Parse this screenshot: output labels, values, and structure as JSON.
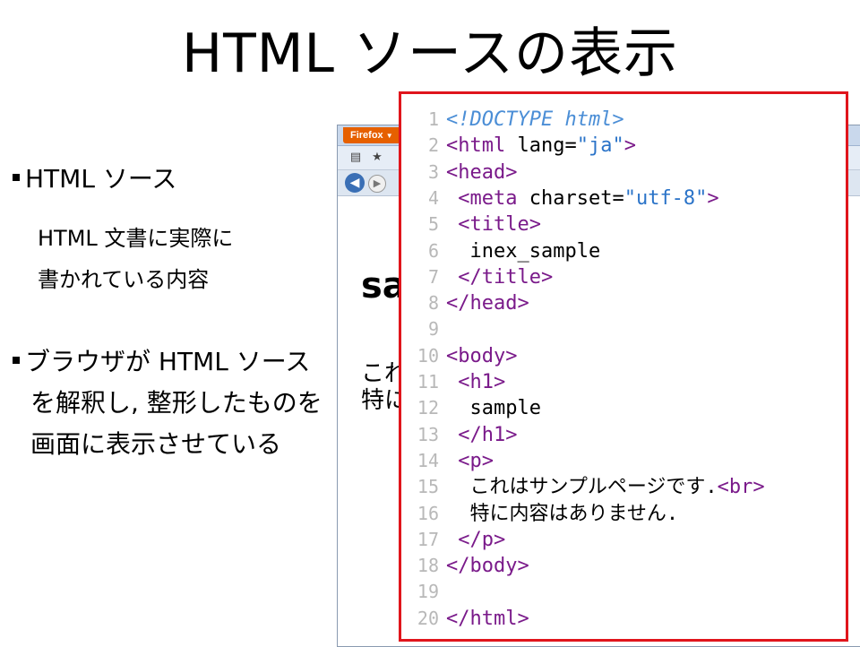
{
  "slide": {
    "title": "HTML ソースの表示",
    "bullets": [
      {
        "label": "HTML ソース",
        "desc_lines": [
          "HTML 文書に実際に",
          "書かれている内容"
        ]
      },
      {
        "label_lines": [
          "ブラウザが HTML ソース",
          "を解釈し, 整形したものを",
          "画面に表示させている"
        ]
      }
    ]
  },
  "browser": {
    "app_button": "Firefox",
    "page": {
      "heading_visible": "sa",
      "para_lines": [
        "これ",
        "特に"
      ]
    }
  },
  "code": {
    "lines": [
      {
        "n": "1",
        "parts": [
          [
            "doc",
            "<!DOCTYPE html>"
          ]
        ]
      },
      {
        "n": "2",
        "parts": [
          [
            "tag",
            "<html"
          ],
          [
            "txt",
            " lang="
          ],
          [
            "str",
            "\"ja\""
          ],
          [
            "tag",
            ">"
          ]
        ]
      },
      {
        "n": "3",
        "parts": [
          [
            "tag",
            "<head>"
          ]
        ]
      },
      {
        "n": "4",
        "parts": [
          [
            "txt",
            " "
          ],
          [
            "tag",
            "<meta"
          ],
          [
            "txt",
            " charset="
          ],
          [
            "str",
            "\"utf-8\""
          ],
          [
            "tag",
            ">"
          ]
        ]
      },
      {
        "n": "5",
        "parts": [
          [
            "txt",
            " "
          ],
          [
            "tag",
            "<title>"
          ]
        ]
      },
      {
        "n": "6",
        "parts": [
          [
            "txt",
            "  inex_sample"
          ]
        ]
      },
      {
        "n": "7",
        "parts": [
          [
            "txt",
            " "
          ],
          [
            "tag",
            "</title>"
          ]
        ]
      },
      {
        "n": "8",
        "parts": [
          [
            "tag",
            "</head>"
          ]
        ]
      },
      {
        "n": "9",
        "parts": []
      },
      {
        "n": "10",
        "parts": [
          [
            "tag",
            "<body>"
          ]
        ]
      },
      {
        "n": "11",
        "parts": [
          [
            "txt",
            " "
          ],
          [
            "tag",
            "<h1>"
          ]
        ]
      },
      {
        "n": "12",
        "parts": [
          [
            "txt",
            "  sample"
          ]
        ]
      },
      {
        "n": "13",
        "parts": [
          [
            "txt",
            " "
          ],
          [
            "tag",
            "</h1>"
          ]
        ]
      },
      {
        "n": "14",
        "parts": [
          [
            "txt",
            " "
          ],
          [
            "tag",
            "<p>"
          ]
        ]
      },
      {
        "n": "15",
        "parts": [
          [
            "txt",
            "  これはサンプルページです."
          ],
          [
            "tag",
            "<br>"
          ]
        ]
      },
      {
        "n": "16",
        "parts": [
          [
            "txt",
            "  特に内容はありません."
          ]
        ]
      },
      {
        "n": "17",
        "parts": [
          [
            "txt",
            " "
          ],
          [
            "tag",
            "</p>"
          ]
        ]
      },
      {
        "n": "18",
        "parts": [
          [
            "tag",
            "</body>"
          ]
        ]
      },
      {
        "n": "19",
        "parts": []
      },
      {
        "n": "20",
        "parts": [
          [
            "tag",
            "</html>"
          ]
        ]
      }
    ]
  },
  "colors": {
    "highlight_border": "#e0151c",
    "tag": "#7a1a8a",
    "string": "#2a73c8",
    "line_number": "#b8b8b8",
    "firefox_button": "#e66000"
  },
  "icons": [
    "bookmark-list-icon",
    "star-icon",
    "back-arrow-icon",
    "forward-arrow-icon"
  ]
}
